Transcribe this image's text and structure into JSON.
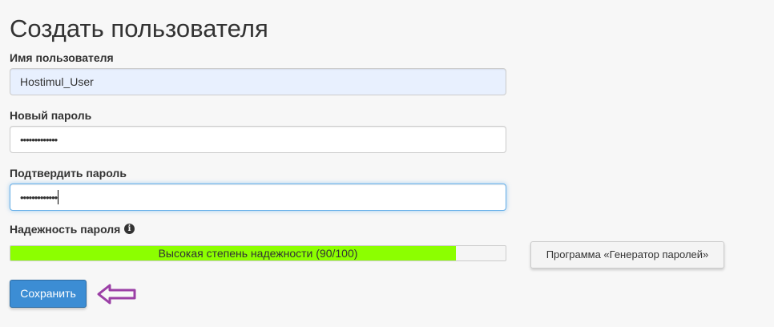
{
  "page": {
    "title": "Создать пользователя"
  },
  "form": {
    "username": {
      "label": "Имя пользователя",
      "value": "Hostimul_User"
    },
    "new_password": {
      "label": "Новый пароль",
      "value": "•••••••••••••"
    },
    "confirm_password": {
      "label": "Подтвердить пароль",
      "value": "•••••••••••••"
    },
    "strength": {
      "label": "Надежность пароля",
      "text": "Высокая степень надежности (90/100)",
      "score": 90,
      "max": 100,
      "fill_color": "#8cff00"
    },
    "generator_button": "Программа «Генератор паролей»",
    "save_button": "Сохранить"
  },
  "icons": {
    "info": "info-circle-icon",
    "arrow": "arrow-left-outline-icon"
  },
  "colors": {
    "primary": "#3c8dd4",
    "arrow": "#9b3fa6",
    "autofill": "#e8f0fe",
    "focus_border": "#66afe9"
  }
}
